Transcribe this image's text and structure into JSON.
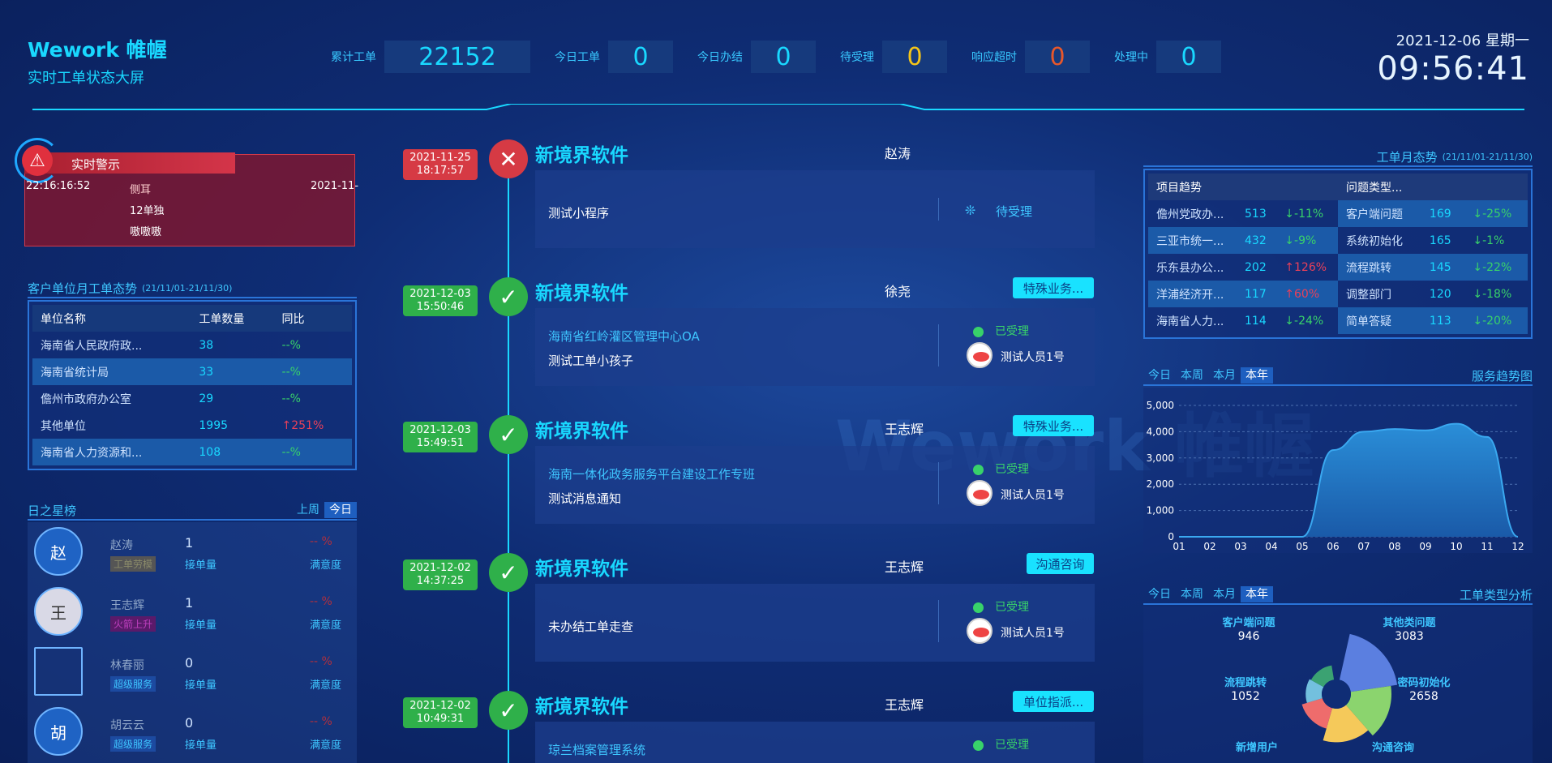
{
  "brand": {
    "title": "Wework 帷幄",
    "subtitle": "实时工单状态大屏"
  },
  "stats": [
    {
      "label": "累计工单",
      "value": "22152",
      "color": "#19d8ff"
    },
    {
      "label": "今日工单",
      "value": "0",
      "color": "#19d8ff"
    },
    {
      "label": "今日办结",
      "value": "0",
      "color": "#19d8ff"
    },
    {
      "label": "待受理",
      "value": "0",
      "color": "#f5c518"
    },
    {
      "label": "响应超时",
      "value": "0",
      "color": "#e8572a"
    },
    {
      "label": "处理中",
      "value": "0",
      "color": "#19d8ff"
    }
  ],
  "clock": {
    "date": "2021-12-06 星期一",
    "time": "09:56:41"
  },
  "watermark": "Wework 帷幄",
  "alert": {
    "title": "实时警示",
    "time": "22:16:16:52",
    "name": "侧耳",
    "line2": "12单独",
    "line3": "嗷嗷嗷",
    "date": "2021-11-"
  },
  "client": {
    "title": "客户单位月工单态势",
    "range": "(21/11/01-21/11/30)",
    "headers": [
      "单位名称",
      "工单数量",
      "同比"
    ],
    "rows": [
      {
        "name": "海南省人民政府政...",
        "count": "38",
        "yoy": "--%",
        "dir": "flat"
      },
      {
        "name": "海南省统计局",
        "count": "33",
        "yoy": "--%",
        "dir": "flat"
      },
      {
        "name": "儋州市政府办公室",
        "count": "29",
        "yoy": "--%",
        "dir": "flat"
      },
      {
        "name": "其他单位",
        "count": "1995",
        "yoy": "↑251%",
        "dir": "up"
      },
      {
        "name": "海南省人力资源和...",
        "count": "108",
        "yoy": "--%",
        "dir": "flat"
      }
    ]
  },
  "stars": {
    "title": "日之星榜",
    "tabs": [
      "上周",
      "今日"
    ],
    "rows": [
      {
        "avatar": "赵",
        "name": "赵涛",
        "badge": "工单劳模",
        "count": "1",
        "count_label": "接单量",
        "pct": "-- %",
        "pct_label": "满意度"
      },
      {
        "avatar": "王",
        "name": "王志辉",
        "badge": "火箭上升",
        "count": "1",
        "count_label": "接单量",
        "pct": "-- %",
        "pct_label": "满意度"
      },
      {
        "avatar": "",
        "name": "林春丽",
        "badge": "超级服务",
        "count": "0",
        "count_label": "接单量",
        "pct": "-- %",
        "pct_label": "满意度"
      },
      {
        "avatar": "胡",
        "name": "胡云云",
        "badge": "超级服务",
        "count": "0",
        "count_label": "接单量",
        "pct": "-- %",
        "pct_label": "满意度"
      }
    ]
  },
  "timeline": [
    {
      "date": "2021-11-25",
      "time": "18:17:57",
      "status": "reject",
      "company": "新境界软件",
      "person": "赵涛",
      "tag": "",
      "title": "",
      "desc": "测试小程序",
      "state": "待受理",
      "user": ""
    },
    {
      "date": "2021-12-03",
      "time": "15:50:46",
      "status": "ok",
      "company": "新境界软件",
      "person": "徐尧",
      "tag": "特殊业务...",
      "title": "海南省红岭灌区管理中心OA",
      "desc": "测试工单小孩子",
      "state": "已受理",
      "user": "测试人员1号"
    },
    {
      "date": "2021-12-03",
      "time": "15:49:51",
      "status": "ok",
      "company": "新境界软件",
      "person": "王志辉",
      "tag": "特殊业务...",
      "title": "海南一体化政务服务平台建设工作专班",
      "desc": "测试消息通知",
      "state": "已受理",
      "user": "测试人员1号"
    },
    {
      "date": "2021-12-02",
      "time": "14:37:25",
      "status": "ok",
      "company": "新境界软件",
      "person": "王志辉",
      "tag": "沟通咨询",
      "title": "",
      "desc": "未办结工单走查",
      "state": "已受理",
      "user": "测试人员1号"
    },
    {
      "date": "2021-12-02",
      "time": "10:49:31",
      "status": "ok",
      "company": "新境界软件",
      "person": "王志辉",
      "tag": "单位指派...",
      "title": "琼兰档案管理系统",
      "desc": "",
      "state": "已受理",
      "user": ""
    }
  ],
  "monthly": {
    "title": "工单月态势",
    "range": "(21/11/01-21/11/30)",
    "left_title": "项目趋势",
    "right_title": "问题类型...",
    "left": [
      {
        "name": "儋州党政办...",
        "value": "513",
        "chg": "↓-11%",
        "dir": "down"
      },
      {
        "name": "三亚市统一...",
        "value": "432",
        "chg": "↓-9%",
        "dir": "down"
      },
      {
        "name": "乐东县办公...",
        "value": "202",
        "chg": "↑126%",
        "dir": "up"
      },
      {
        "name": "洋浦经济开...",
        "value": "117",
        "chg": "↑60%",
        "dir": "up"
      },
      {
        "name": "海南省人力...",
        "value": "114",
        "chg": "↓-24%",
        "dir": "down"
      }
    ],
    "right": [
      {
        "name": "客户端问题",
        "value": "169",
        "chg": "↓-25%",
        "dir": "down"
      },
      {
        "name": "系统初始化",
        "value": "165",
        "chg": "↓-1%",
        "dir": "down"
      },
      {
        "name": "流程跳转",
        "value": "145",
        "chg": "↓-22%",
        "dir": "down"
      },
      {
        "name": "调整部门",
        "value": "120",
        "chg": "↓-18%",
        "dir": "down"
      },
      {
        "name": "简单答疑",
        "value": "113",
        "chg": "↓-20%",
        "dir": "down"
      }
    ]
  },
  "service": {
    "tabs": [
      "今日",
      "本周",
      "本月",
      "本年"
    ],
    "title": "服务趋势图"
  },
  "types": {
    "tabs": [
      "今日",
      "本周",
      "本月",
      "本年"
    ],
    "title": "工单类型分析"
  },
  "chart_data": [
    {
      "type": "area",
      "title": "服务趋势图",
      "x": [
        "01",
        "02",
        "03",
        "04",
        "05",
        "06",
        "07",
        "08",
        "09",
        "10",
        "11",
        "12"
      ],
      "values": [
        0,
        0,
        0,
        0,
        0,
        3300,
        4000,
        4100,
        4050,
        4300,
        3800,
        0
      ],
      "ylim": [
        0,
        5000
      ],
      "yticks": [
        "0",
        "1,000",
        "2,000",
        "3,000",
        "4,000",
        "5,000"
      ],
      "grid": true
    },
    {
      "type": "pie",
      "title": "工单类型分析",
      "slices": [
        {
          "label": "其他类问题",
          "value": 3083,
          "color": "#5b7fe0"
        },
        {
          "label": "密码初始化",
          "value": 2658,
          "color": "#8bd46e"
        },
        {
          "label": "沟通咨询",
          "value": 2200,
          "color": "#f5c95a"
        },
        {
          "label": "新增用户",
          "value": 1400,
          "color": "#ee6c6c"
        },
        {
          "label": "流程跳转",
          "value": 1052,
          "color": "#73c0de"
        },
        {
          "label": "客户端问题",
          "value": 946,
          "color": "#3ba272"
        }
      ],
      "labels": [
        {
          "label": "客户端问题",
          "value": "946"
        },
        {
          "label": "其他类问题",
          "value": "3083"
        },
        {
          "label": "流程跳转",
          "value": "1052"
        },
        {
          "label": "密码初始化",
          "value": "2658"
        },
        {
          "label": "新增用户",
          "value": ""
        },
        {
          "label": "沟通咨询",
          "value": ""
        }
      ]
    }
  ]
}
